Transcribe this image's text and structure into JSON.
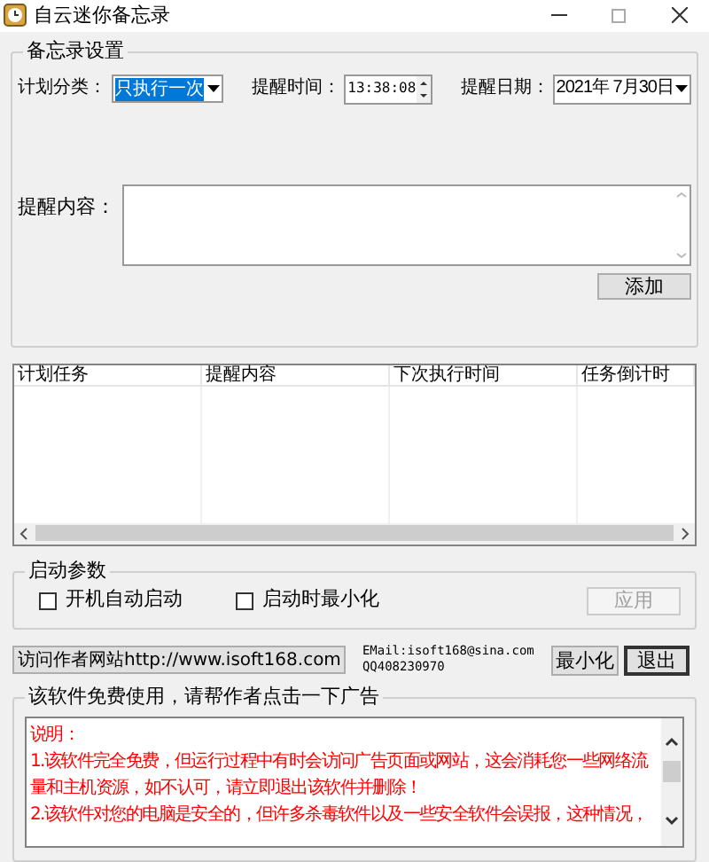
{
  "window": {
    "title": "自云迷你备忘录"
  },
  "settings": {
    "legend": "备忘录设置",
    "plan_label": "计划分类：",
    "plan_value": "只执行一次",
    "time_label": "提醒时间：",
    "time_value": "13:38:08",
    "date_label": "提醒日期：",
    "date_value": "2021年 7月30日",
    "content_label": "提醒内容：",
    "add_button": "添加"
  },
  "table": {
    "columns": [
      "计划任务",
      "提醒内容",
      "下次执行时间",
      "任务倒计时"
    ]
  },
  "startup": {
    "legend": "启动参数",
    "options": [
      {
        "label": "开机自动启动",
        "checked": false
      },
      {
        "label": "启动时最小化",
        "checked": false
      }
    ],
    "apply_button": {
      "label": "应用",
      "disabled": true
    }
  },
  "actions": {
    "visit_button": "访问作者网站http://www.isoft168.com",
    "email": "EMail:isoft168@sina.com",
    "qq": "QQ408230970",
    "minimize_button": "最小化",
    "exit_button": "退出"
  },
  "ad": {
    "legend": "该软件免费使用，请帮作者点击一下广告",
    "paragraphs": [
      "说明：",
      "1.该软件完全免费，但运行过程中有时会访问广告页面或网站，这会消耗您一些网络流量和主机资源，如不认可，请立即退出该软件并删除！",
      "2.该软件对您的电脑是安全的，但许多杀毒软件以及一些安全软件会误报，这种情况，"
    ]
  }
}
